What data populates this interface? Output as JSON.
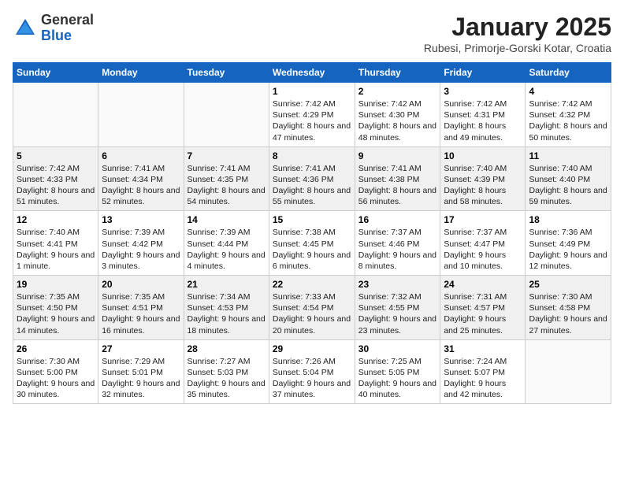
{
  "header": {
    "logo_general": "General",
    "logo_blue": "Blue",
    "title": "January 2025",
    "subtitle": "Rubesi, Primorje-Gorski Kotar, Croatia"
  },
  "weekdays": [
    "Sunday",
    "Monday",
    "Tuesday",
    "Wednesday",
    "Thursday",
    "Friday",
    "Saturday"
  ],
  "weeks": [
    [
      {
        "day": "",
        "info": ""
      },
      {
        "day": "",
        "info": ""
      },
      {
        "day": "",
        "info": ""
      },
      {
        "day": "1",
        "info": "Sunrise: 7:42 AM\nSunset: 4:29 PM\nDaylight: 8 hours and 47 minutes."
      },
      {
        "day": "2",
        "info": "Sunrise: 7:42 AM\nSunset: 4:30 PM\nDaylight: 8 hours and 48 minutes."
      },
      {
        "day": "3",
        "info": "Sunrise: 7:42 AM\nSunset: 4:31 PM\nDaylight: 8 hours and 49 minutes."
      },
      {
        "day": "4",
        "info": "Sunrise: 7:42 AM\nSunset: 4:32 PM\nDaylight: 8 hours and 50 minutes."
      }
    ],
    [
      {
        "day": "5",
        "info": "Sunrise: 7:42 AM\nSunset: 4:33 PM\nDaylight: 8 hours and 51 minutes."
      },
      {
        "day": "6",
        "info": "Sunrise: 7:41 AM\nSunset: 4:34 PM\nDaylight: 8 hours and 52 minutes."
      },
      {
        "day": "7",
        "info": "Sunrise: 7:41 AM\nSunset: 4:35 PM\nDaylight: 8 hours and 54 minutes."
      },
      {
        "day": "8",
        "info": "Sunrise: 7:41 AM\nSunset: 4:36 PM\nDaylight: 8 hours and 55 minutes."
      },
      {
        "day": "9",
        "info": "Sunrise: 7:41 AM\nSunset: 4:38 PM\nDaylight: 8 hours and 56 minutes."
      },
      {
        "day": "10",
        "info": "Sunrise: 7:40 AM\nSunset: 4:39 PM\nDaylight: 8 hours and 58 minutes."
      },
      {
        "day": "11",
        "info": "Sunrise: 7:40 AM\nSunset: 4:40 PM\nDaylight: 8 hours and 59 minutes."
      }
    ],
    [
      {
        "day": "12",
        "info": "Sunrise: 7:40 AM\nSunset: 4:41 PM\nDaylight: 9 hours and 1 minute."
      },
      {
        "day": "13",
        "info": "Sunrise: 7:39 AM\nSunset: 4:42 PM\nDaylight: 9 hours and 3 minutes."
      },
      {
        "day": "14",
        "info": "Sunrise: 7:39 AM\nSunset: 4:44 PM\nDaylight: 9 hours and 4 minutes."
      },
      {
        "day": "15",
        "info": "Sunrise: 7:38 AM\nSunset: 4:45 PM\nDaylight: 9 hours and 6 minutes."
      },
      {
        "day": "16",
        "info": "Sunrise: 7:37 AM\nSunset: 4:46 PM\nDaylight: 9 hours and 8 minutes."
      },
      {
        "day": "17",
        "info": "Sunrise: 7:37 AM\nSunset: 4:47 PM\nDaylight: 9 hours and 10 minutes."
      },
      {
        "day": "18",
        "info": "Sunrise: 7:36 AM\nSunset: 4:49 PM\nDaylight: 9 hours and 12 minutes."
      }
    ],
    [
      {
        "day": "19",
        "info": "Sunrise: 7:35 AM\nSunset: 4:50 PM\nDaylight: 9 hours and 14 minutes."
      },
      {
        "day": "20",
        "info": "Sunrise: 7:35 AM\nSunset: 4:51 PM\nDaylight: 9 hours and 16 minutes."
      },
      {
        "day": "21",
        "info": "Sunrise: 7:34 AM\nSunset: 4:53 PM\nDaylight: 9 hours and 18 minutes."
      },
      {
        "day": "22",
        "info": "Sunrise: 7:33 AM\nSunset: 4:54 PM\nDaylight: 9 hours and 20 minutes."
      },
      {
        "day": "23",
        "info": "Sunrise: 7:32 AM\nSunset: 4:55 PM\nDaylight: 9 hours and 23 minutes."
      },
      {
        "day": "24",
        "info": "Sunrise: 7:31 AM\nSunset: 4:57 PM\nDaylight: 9 hours and 25 minutes."
      },
      {
        "day": "25",
        "info": "Sunrise: 7:30 AM\nSunset: 4:58 PM\nDaylight: 9 hours and 27 minutes."
      }
    ],
    [
      {
        "day": "26",
        "info": "Sunrise: 7:30 AM\nSunset: 5:00 PM\nDaylight: 9 hours and 30 minutes."
      },
      {
        "day": "27",
        "info": "Sunrise: 7:29 AM\nSunset: 5:01 PM\nDaylight: 9 hours and 32 minutes."
      },
      {
        "day": "28",
        "info": "Sunrise: 7:27 AM\nSunset: 5:03 PM\nDaylight: 9 hours and 35 minutes."
      },
      {
        "day": "29",
        "info": "Sunrise: 7:26 AM\nSunset: 5:04 PM\nDaylight: 9 hours and 37 minutes."
      },
      {
        "day": "30",
        "info": "Sunrise: 7:25 AM\nSunset: 5:05 PM\nDaylight: 9 hours and 40 minutes."
      },
      {
        "day": "31",
        "info": "Sunrise: 7:24 AM\nSunset: 5:07 PM\nDaylight: 9 hours and 42 minutes."
      },
      {
        "day": "",
        "info": ""
      }
    ]
  ]
}
